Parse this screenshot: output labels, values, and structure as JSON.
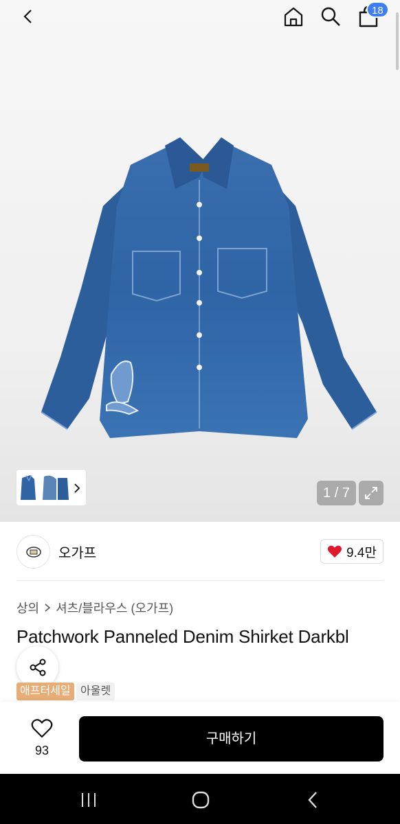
{
  "header": {
    "back_icon": "chevron-left-icon",
    "home_icon": "home-icon",
    "search_icon": "search-icon",
    "bag_icon": "shopping-bag-icon",
    "bag_badge": "18"
  },
  "gallery": {
    "counter": "1 / 7",
    "expand_icon": "expand-icon",
    "thumb_next_icon": "chevron-right-icon"
  },
  "store": {
    "name": "오가프",
    "like_count": "9.4만"
  },
  "product": {
    "breadcrumb": [
      "상의",
      "셔츠/블라우스 (오가프)"
    ],
    "title": "Patchwork Panneled Denim Shirket Darkbl",
    "tags": [
      "애프터세일",
      "아울렛"
    ]
  },
  "actions": {
    "wish_count": "93",
    "buy_label": "구매하기"
  },
  "colors": {
    "accent_badge": "#3d7ff0",
    "sale_tag": "#e7ad76",
    "like_heart": "#e0182d",
    "buy_button": "#000000"
  }
}
